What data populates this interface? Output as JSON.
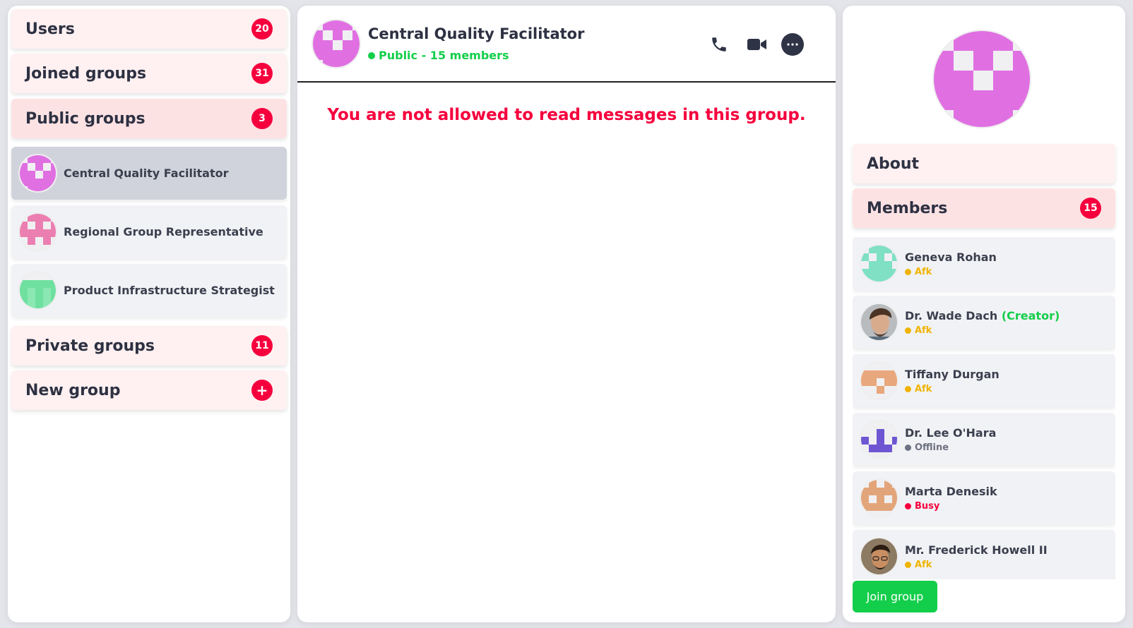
{
  "sidebar": {
    "users": {
      "label": "Users",
      "count": "20"
    },
    "joined_groups": {
      "label": "Joined groups",
      "count": "31"
    },
    "public_groups": {
      "label": "Public groups",
      "count": "3"
    },
    "groups": [
      {
        "name": "Central Quality Facilitator",
        "avatar_color": "#e070e2"
      },
      {
        "name": "Regional Group Representative",
        "avatar_color": "#ec7fb1"
      },
      {
        "name": "Product Infrastructure Strategist",
        "avatar_color": "#6fe09f"
      }
    ],
    "private_groups": {
      "label": "Private groups",
      "count": "11"
    },
    "new_group": {
      "label": "New group",
      "icon": "plus-icon"
    }
  },
  "chat": {
    "title": "Central Quality Facilitator",
    "status": "Public - 15 members",
    "status_color": "#13ce4a",
    "error": "You are not allowed to read messages in this group.",
    "icons": [
      "phone-icon",
      "video-camera-icon",
      "more-options-icon"
    ]
  },
  "details": {
    "about_label": "About",
    "members_label": "Members",
    "members_count": "15",
    "members": [
      {
        "name": "Geneva Rohan",
        "creator": "",
        "status": "Afk",
        "status_color": "#f0b400",
        "avatar_color": "#7fe0c3"
      },
      {
        "name": "Dr. Wade Dach",
        "creator": "(Creator)",
        "status": "Afk",
        "status_color": "#f0b400",
        "avatar_color": "#6b5a4d"
      },
      {
        "name": "Tiffany Durgan",
        "creator": "",
        "status": "Afk",
        "status_color": "#f0b400",
        "avatar_color": "#e8a77c"
      },
      {
        "name": "Dr. Lee O'Hara",
        "creator": "",
        "status": "Offline",
        "status_color": "#6e7180",
        "avatar_color": "#6e56d2"
      },
      {
        "name": "Marta Denesik",
        "creator": "",
        "status": "Busy",
        "status_color": "#f5003d",
        "avatar_color": "#e2a57a"
      },
      {
        "name": "Mr. Frederick Howell II",
        "creator": "",
        "status": "Afk",
        "status_color": "#f0b400",
        "avatar_color": "#7a5a3c"
      }
    ],
    "join_label": "Join group"
  },
  "colors": {
    "accent": "#f5003d",
    "success": "#13ce4a"
  }
}
